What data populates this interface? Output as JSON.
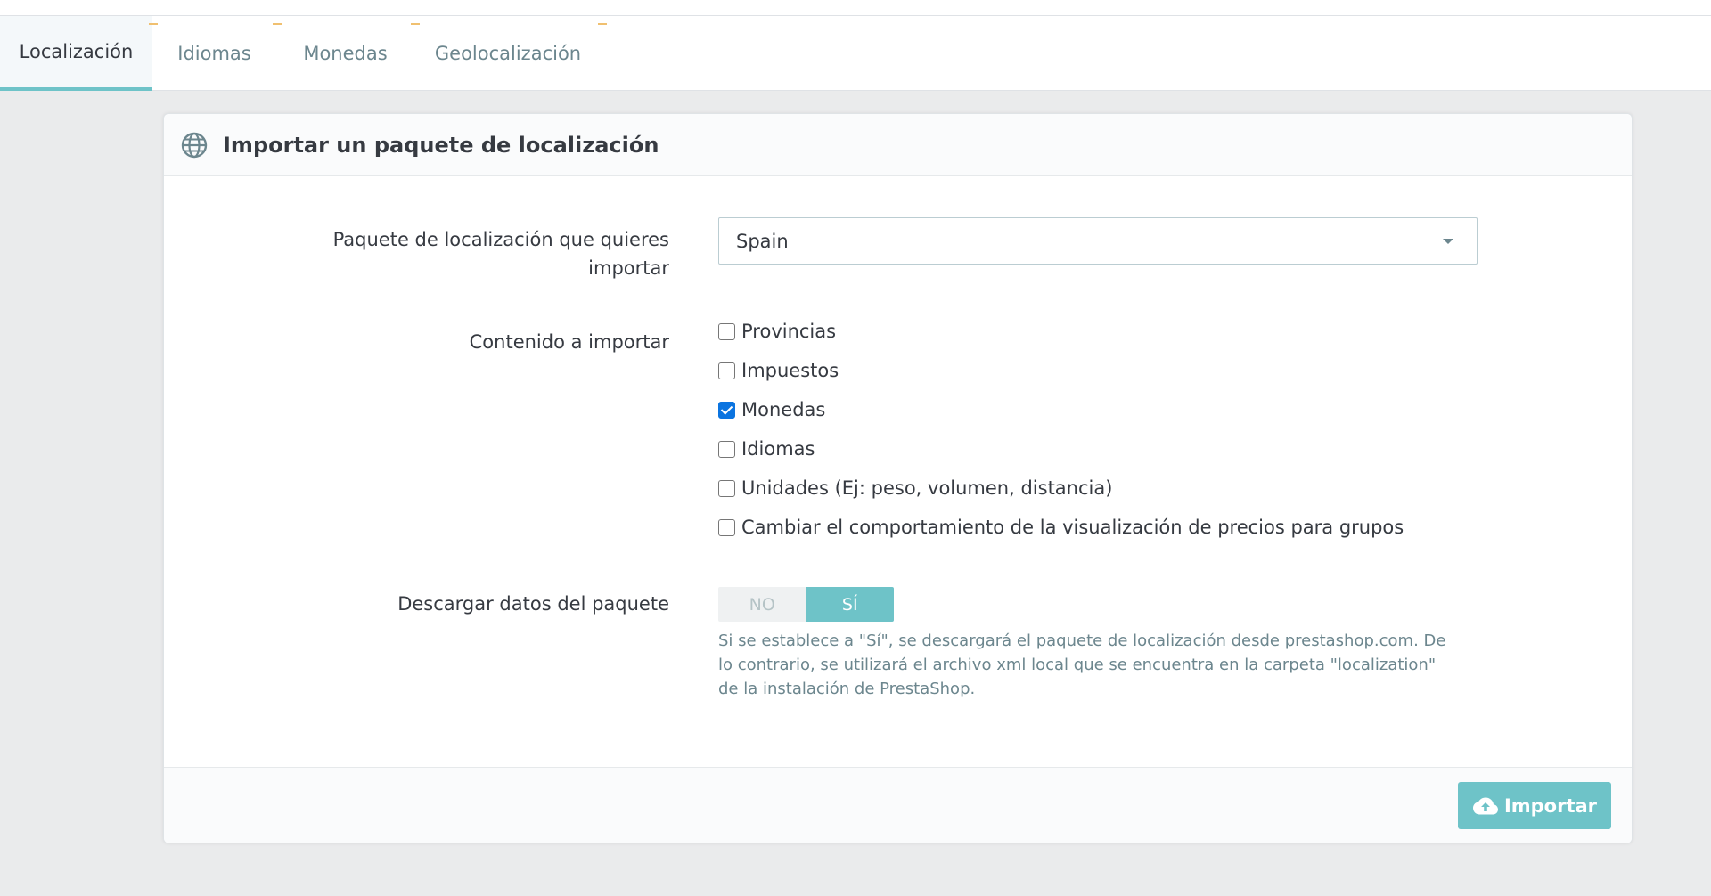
{
  "tabs": [
    {
      "label": "Localización",
      "active": true
    },
    {
      "label": "Idiomas",
      "active": false
    },
    {
      "label": "Monedas",
      "active": false
    },
    {
      "label": "Geolocalización",
      "active": false
    }
  ],
  "panel": {
    "title": "Importar un paquete de localización",
    "icon": "globe-icon"
  },
  "form": {
    "pack_label": "Paquete de localización que quieres importar",
    "pack_value": "Spain",
    "content_label": "Contenido a importar",
    "content_options": [
      {
        "label": "Provincias",
        "checked": false
      },
      {
        "label": "Impuestos",
        "checked": false
      },
      {
        "label": "Monedas",
        "checked": true
      },
      {
        "label": "Idiomas",
        "checked": false
      },
      {
        "label": "Unidades (Ej: peso, volumen, distancia)",
        "checked": false
      },
      {
        "label": "Cambiar el comportamiento de la visualización de precios para grupos",
        "checked": false
      }
    ],
    "download_label": "Descargar datos del paquete",
    "download_no": "NO",
    "download_yes": "SÍ",
    "download_selected": "SÍ",
    "download_help": "Si se establece a \"Sí\", se descargará el paquete de localización desde prestashop.com. De lo contrario, se utilizará el archivo xml local que se encuentra en la carpeta \"localization\" de la instalación de PrestaShop."
  },
  "footer": {
    "import_label": "Importar",
    "import_icon": "cloud-upload-icon"
  },
  "colors": {
    "accent": "#6ec3c8",
    "checkbox_checked": "#0b74e0",
    "background": "#eaebec"
  }
}
